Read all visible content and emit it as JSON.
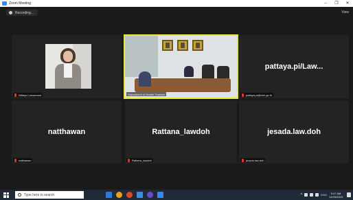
{
  "window": {
    "title": "Zoom Meeting",
    "controls": [
      "–",
      "❐",
      "✕"
    ]
  },
  "meeting": {
    "recording_label": "Recording...",
    "view_label": "View",
    "tiles": [
      {
        "label": "Nittaya Lonsamoot",
        "type": "video-woman"
      },
      {
        "label": "Department of Health Thailand",
        "type": "video-room",
        "active": true
      },
      {
        "label": "pattaya.pi@doh.go.th",
        "display_name": "pattaya.pi/Law..."
      },
      {
        "label": "natthawan",
        "display_name": "natthawan"
      },
      {
        "label": "Rattana_lawdoh",
        "display_name": "Rattana_lawdoh"
      },
      {
        "label": "jesada.law.doh",
        "display_name": "jesada.law.doh"
      }
    ]
  },
  "taskbar": {
    "search_placeholder": "Type here to search",
    "language": "ENG",
    "time": "9:47 AM",
    "date": "12/25/2023",
    "app_colors": [
      "#2d7ad6",
      "#e8a317",
      "#d84b2a",
      "#3a8ee6",
      "#6a4bc4",
      "#2d8cff"
    ]
  },
  "colors": {
    "active_border": "#e8e82a",
    "zoom_blue": "#2d8cff",
    "mic_red": "#e0392b"
  }
}
